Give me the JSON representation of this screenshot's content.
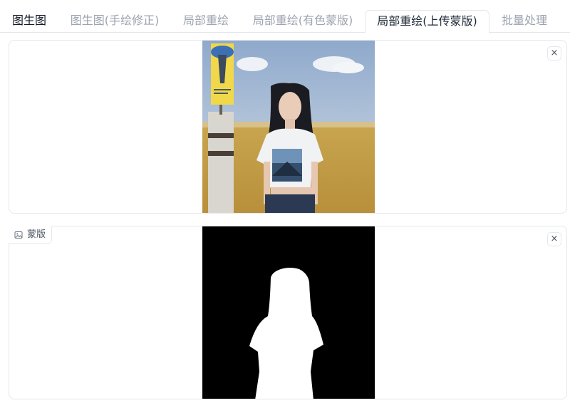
{
  "tabs": [
    {
      "label": "图生图"
    },
    {
      "label": "图生图(手绘修正)"
    },
    {
      "label": "局部重绘"
    },
    {
      "label": "局部重绘(有色蒙版)"
    },
    {
      "label": "局部重绘(上传蒙版)"
    },
    {
      "label": "批量处理"
    }
  ],
  "selected_tab_index": 4,
  "image_panel": {
    "close_icon": "×",
    "image_description": "photo of a woman in a white t-shirt standing in a yellow grass field next to a signpost"
  },
  "mask_panel": {
    "label": "蒙版",
    "label_icon": "image-icon",
    "close_icon": "×"
  },
  "colors": {
    "sky": "#9fb7d4",
    "field": "#c9a84a",
    "mask_bg": "#000000",
    "mask_fg": "#ffffff",
    "border": "#e5e7eb"
  }
}
